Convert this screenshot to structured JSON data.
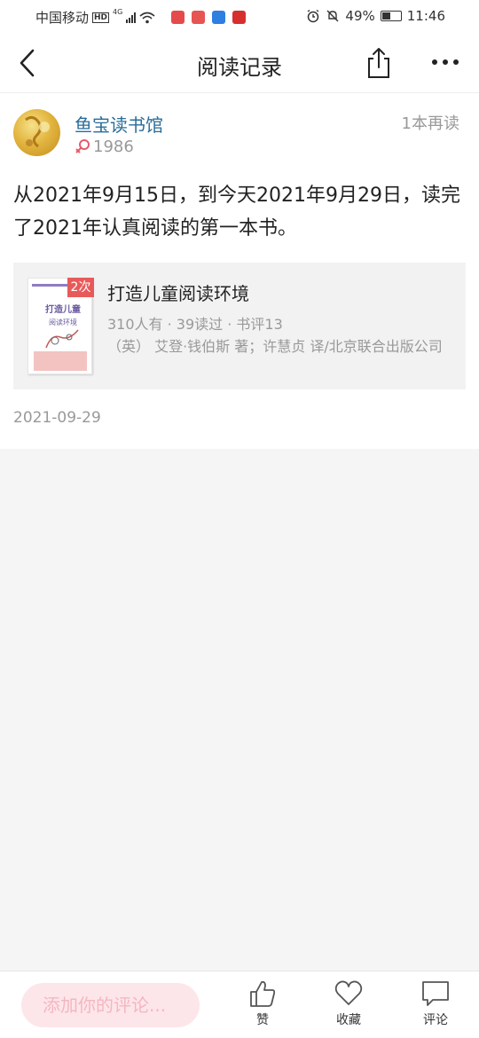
{
  "status_bar": {
    "carrier": "中国移动",
    "hd": "HD",
    "network": "4G",
    "battery": "49%",
    "battery_level": 0.49,
    "time": "11:46"
  },
  "nav": {
    "title": "阅读记录"
  },
  "post": {
    "username": "鱼宝读书馆",
    "birth_year": "1986",
    "reread": "1本再读",
    "text": "从2021年9月15日，到今天2021年9月29日，读完了2021年认真阅读的第一本书。",
    "date": "2021-09-29"
  },
  "book": {
    "count_badge": "2次",
    "title": "打造儿童阅读环境",
    "stats": "310人有 · 39读过 · 书评13",
    "author": "（英） 艾登·钱伯斯 著；许慧贞 译/北京联合出版公司",
    "cover_title": "打造儿童",
    "cover_subtitle": "阅读环境"
  },
  "bottom_bar": {
    "comment_placeholder": "添加你的评论...",
    "like_label": "赞",
    "favorite_label": "收藏",
    "comment_label": "评论"
  },
  "colors": {
    "username": "#2a6c9a",
    "badge": "#e85a5a",
    "comment_input_bg": "#fde6ea",
    "gender_icon": "#e85a6a"
  }
}
